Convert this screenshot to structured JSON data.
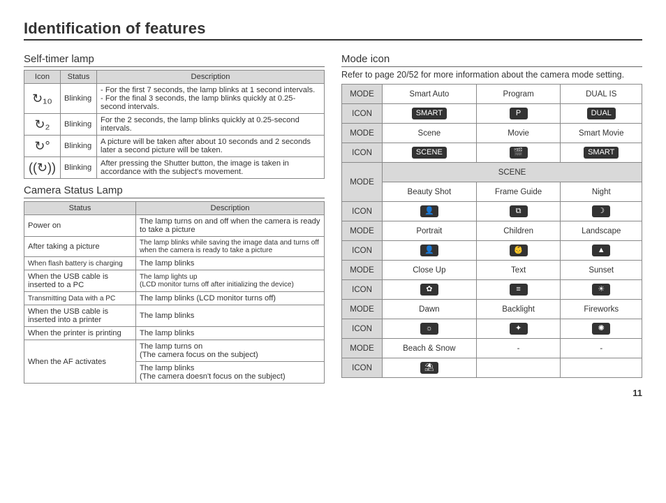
{
  "page_title": "Identification of features",
  "page_number": "11",
  "left": {
    "self_timer": {
      "heading": "Self-timer lamp",
      "headers": [
        "Icon",
        "Status",
        "Description"
      ],
      "rows": [
        {
          "icon": "↻₁₀",
          "status": "Blinking",
          "desc": "- For the first 7 seconds, the lamp blinks at 1 second intervals.\n- For the final 3 seconds, the lamp blinks quickly at 0.25-second intervals."
        },
        {
          "icon": "↻₂",
          "status": "Blinking",
          "desc": "For the 2 seconds, the lamp blinks quickly at 0.25-second intervals."
        },
        {
          "icon": "↻°",
          "status": "Blinking",
          "desc": "A picture will be taken after about 10 seconds and 2 seconds later a second picture will be taken."
        },
        {
          "icon": "((↻))",
          "status": "Blinking",
          "desc": "After pressing the Shutter button, the image is taken in accordance with the subject's movement."
        }
      ]
    },
    "status_lamp": {
      "heading": "Camera Status Lamp",
      "headers": [
        "Status",
        "Description"
      ],
      "rows": [
        {
          "status": "Power on",
          "desc": "The lamp turns on and off when the camera is ready to take a picture"
        },
        {
          "status": "After taking a picture",
          "desc": "The lamp blinks while saving the image data and turns off when the camera is ready to take a picture",
          "desc_small": true
        },
        {
          "status": "When flash battery is charging",
          "status_small": true,
          "desc": "The lamp blinks"
        },
        {
          "status": "When the USB cable is inserted to a PC",
          "desc": "The lamp lights up\n(LCD monitor turns off after initializing the device)",
          "desc_small": true
        },
        {
          "status": "Transmitting Data with a PC",
          "status_small": true,
          "desc": "The lamp blinks (LCD monitor turns off)"
        },
        {
          "status": "When the USB cable is inserted into a printer",
          "desc": "The lamp blinks"
        },
        {
          "status": "When the printer is printing",
          "desc": "The lamp blinks"
        }
      ],
      "af_row": {
        "status": "When the AF activates",
        "desc1": "The lamp turns on\n(The camera focus on the subject)",
        "desc2": "The lamp blinks\n(The camera doesn't focus on the subject)"
      }
    }
  },
  "right": {
    "heading": "Mode icon",
    "note": "Refer to page 20/52 for more information about the camera mode setting.",
    "label_mode": "MODE",
    "label_icon": "ICON",
    "scene_label": "SCENE",
    "top_modes": [
      {
        "name": "Smart Auto",
        "icon": "SMART"
      },
      {
        "name": "Program",
        "icon": "P"
      },
      {
        "name": "DUAL IS",
        "icon": "DUAL"
      }
    ],
    "top_modes2": [
      {
        "name": "Scene",
        "icon": "SCENE"
      },
      {
        "name": "Movie",
        "icon": "🎬"
      },
      {
        "name": "Smart Movie",
        "icon": "SMART"
      }
    ],
    "scene_rows": [
      [
        {
          "name": "Beauty Shot",
          "icon": "👤"
        },
        {
          "name": "Frame Guide",
          "icon": "⧉"
        },
        {
          "name": "Night",
          "icon": "☽"
        }
      ],
      [
        {
          "name": "Portrait",
          "icon": "👤"
        },
        {
          "name": "Children",
          "icon": "👶"
        },
        {
          "name": "Landscape",
          "icon": "▲"
        }
      ],
      [
        {
          "name": "Close Up",
          "icon": "✿"
        },
        {
          "name": "Text",
          "icon": "≡"
        },
        {
          "name": "Sunset",
          "icon": "☀"
        }
      ],
      [
        {
          "name": "Dawn",
          "icon": "☼"
        },
        {
          "name": "Backlight",
          "icon": "✦"
        },
        {
          "name": "Fireworks",
          "icon": "✺"
        }
      ],
      [
        {
          "name": "Beach & Snow",
          "icon": "⛱"
        },
        {
          "name": "-",
          "icon": ""
        },
        {
          "name": "-",
          "icon": ""
        }
      ]
    ]
  }
}
